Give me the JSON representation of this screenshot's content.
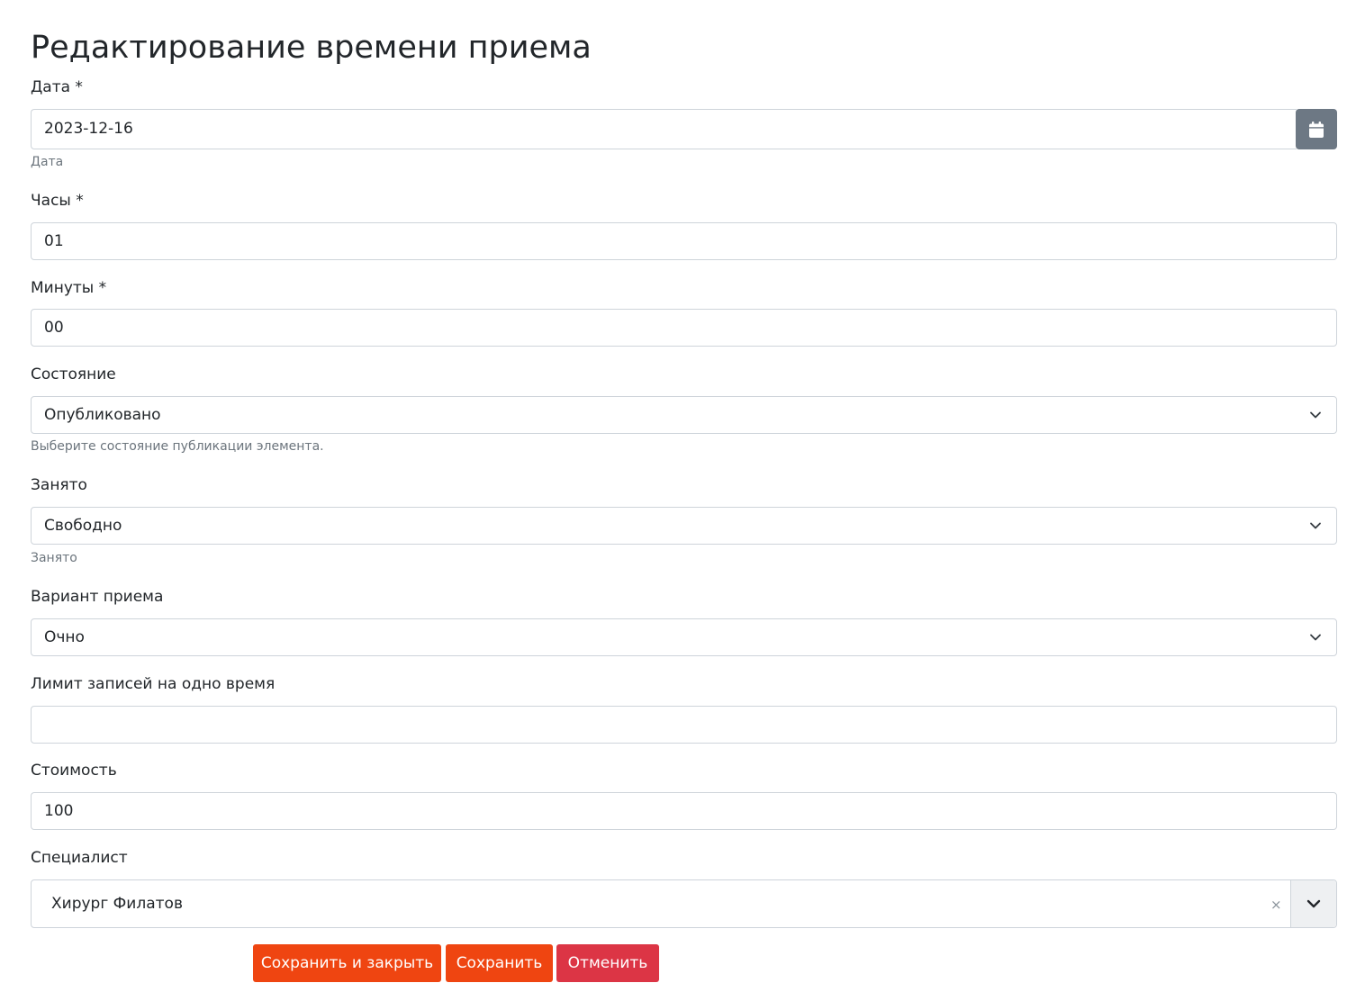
{
  "page": {
    "title": "Редактирование времени приема"
  },
  "form": {
    "date": {
      "label": "Дата *",
      "value": "2023-12-16",
      "hint": "Дата"
    },
    "hours": {
      "label": "Часы *",
      "value": "01"
    },
    "minutes": {
      "label": "Минуты *",
      "value": "00"
    },
    "state": {
      "label": "Состояние",
      "value": "Опубликовано",
      "hint": "Выберите состояние публикации элемента."
    },
    "busy": {
      "label": "Занято",
      "value": "Свободно",
      "hint": "Занято"
    },
    "variant": {
      "label": "Вариант приема",
      "value": "Очно"
    },
    "limit": {
      "label": "Лимит записей на одно время",
      "value": ""
    },
    "cost": {
      "label": "Стоимость",
      "value": "100"
    },
    "specialist": {
      "label": "Специалист",
      "value": "Хирург Филатов",
      "clear": "×"
    }
  },
  "actions": {
    "save_close": "Сохранить и закрыть",
    "save": "Сохранить",
    "cancel": "Отменить"
  },
  "colors": {
    "primary": "#ef4511",
    "danger": "#dc3545",
    "calendar_button": "#6d7884"
  },
  "icons": {
    "calendar": "calendar-icon",
    "chevron": "chevron-down-icon"
  }
}
